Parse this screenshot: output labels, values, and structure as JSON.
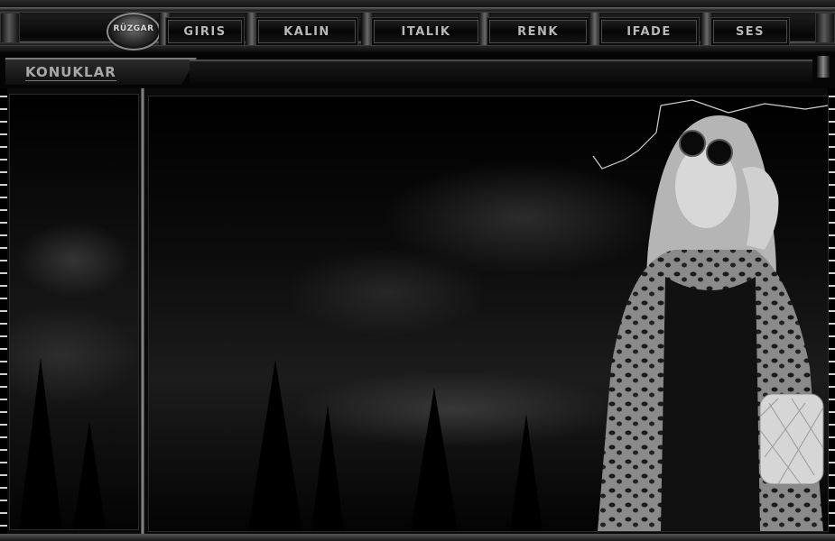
{
  "header": {
    "logo_text": "RÜZGAR",
    "nav": [
      {
        "label": "GIRIS"
      },
      {
        "label": "KALIN"
      },
      {
        "label": "ITALIK"
      },
      {
        "label": "RENK"
      },
      {
        "label": "IFADE"
      },
      {
        "label": "SES"
      }
    ]
  },
  "panel": {
    "title": "KONUKLAR"
  },
  "icons": {
    "logo": "logo-badge-icon"
  },
  "colors": {
    "background": "#0a0a0a",
    "chrome": "#7a7a7a",
    "label": "#b8b8b8"
  }
}
